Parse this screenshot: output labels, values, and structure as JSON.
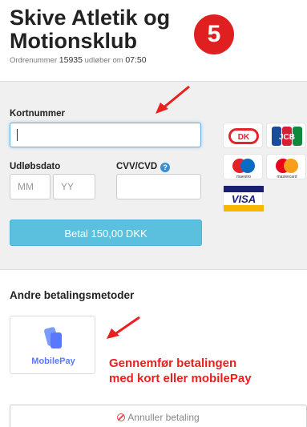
{
  "header": {
    "title": "Skive Atletik og Motionsklub",
    "order_prefix": "Ordrenummer",
    "order_number": "15935",
    "expires_text": "udløber om",
    "expires_time": "07:50"
  },
  "step_badge": "5",
  "card_form": {
    "card_number_label": "Kortnummer",
    "card_number_value": "",
    "expiry_label": "Udløbsdato",
    "month_placeholder": "MM",
    "year_placeholder": "YY",
    "cvv_label": "CVV/CVD",
    "cvv_help_icon": "question-icon",
    "pay_button_label": "Betal 150,00 DKK"
  },
  "card_logos": [
    {
      "name": "dankort",
      "label": "DK"
    },
    {
      "name": "jcb",
      "label": "JCB"
    },
    {
      "name": "maestro",
      "label": "maestro"
    },
    {
      "name": "mastercard",
      "label": "mastercard"
    },
    {
      "name": "visa",
      "label": "VISA"
    }
  ],
  "alternatives": {
    "title": "Andre betalingsmetoder",
    "mobilepay_label": "MobilePay"
  },
  "annotation": {
    "line1": "Gennemfør betalingen",
    "line2": "med kort eller mobilePay"
  },
  "cancel_label": "Annuller betaling",
  "colors": {
    "accent_red": "#e02020",
    "pay_button": "#5bc0de",
    "mobilepay_blue": "#5a78ff"
  }
}
